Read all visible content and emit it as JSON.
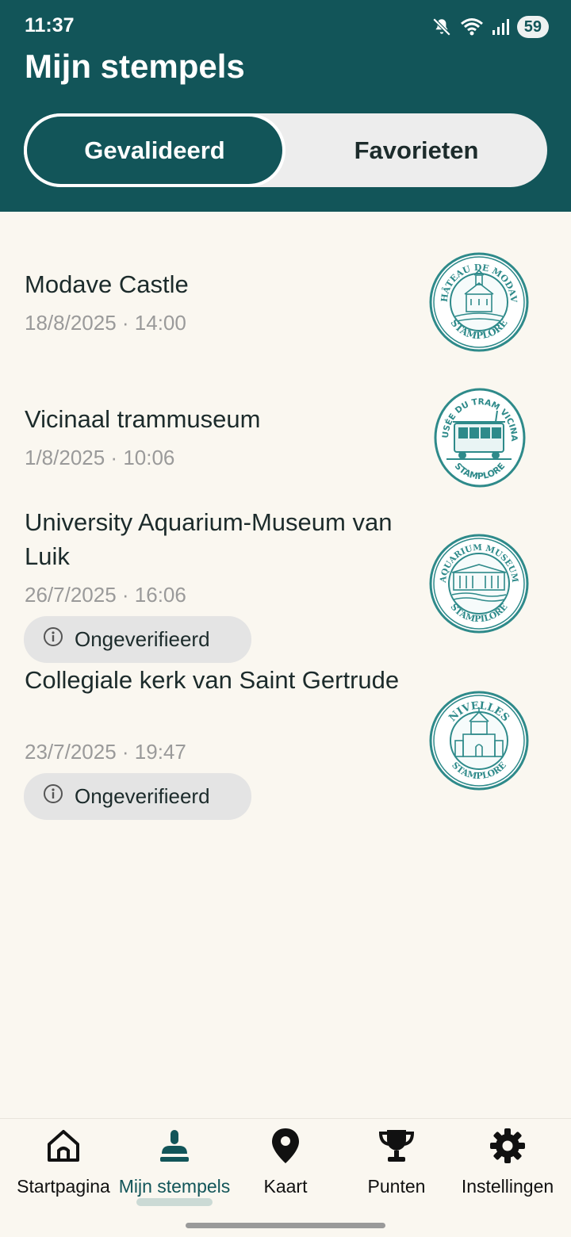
{
  "status": {
    "time": "11:37",
    "battery": "59"
  },
  "header": {
    "title": "Mijn stempels"
  },
  "tabs": {
    "active": "Gevalideerd",
    "inactive": "Favorieten"
  },
  "items": [
    {
      "title": "Modave Castle",
      "date": "18/8/2025 · 14:00",
      "badge": "",
      "stamp": {
        "top_text": "CHÂTEAU DE MODAVE",
        "bottom_text": "STAMPLORE"
      }
    },
    {
      "title": "Vicinaal trammuseum",
      "date": "1/8/2025 · 10:06",
      "badge": "",
      "stamp": {
        "top_text": "MUSÉE DU TRAM VICINAL",
        "bottom_text": "STAMPLORE"
      }
    },
    {
      "title": "University Aquarium-Museum van Luik",
      "date": "26/7/2025 · 16:06",
      "badge": "Ongeverifieerd",
      "stamp": {
        "top_text": "AQUARIUM MUSEUM",
        "bottom_text": "STAMPILORE"
      }
    },
    {
      "title": "Collegiale kerk van Saint Gertrude",
      "date": "23/7/2025 · 19:47",
      "badge": "Ongeverifieerd",
      "stamp": {
        "top_text": "NIVELLES",
        "bottom_text": "STAMPLORE"
      }
    }
  ],
  "nav": [
    {
      "label": "Startpagina",
      "icon": "home-icon",
      "active": false
    },
    {
      "label": "Mijn stempels",
      "icon": "stamp-icon",
      "active": true
    },
    {
      "label": "Kaart",
      "icon": "map-pin-icon",
      "active": false
    },
    {
      "label": "Punten",
      "icon": "trophy-icon",
      "active": false
    },
    {
      "label": "Instellingen",
      "icon": "gear-icon",
      "active": false
    }
  ],
  "colors": {
    "primary": "#125559",
    "background": "#faf7f0",
    "stamp": "#2e8a8a"
  }
}
